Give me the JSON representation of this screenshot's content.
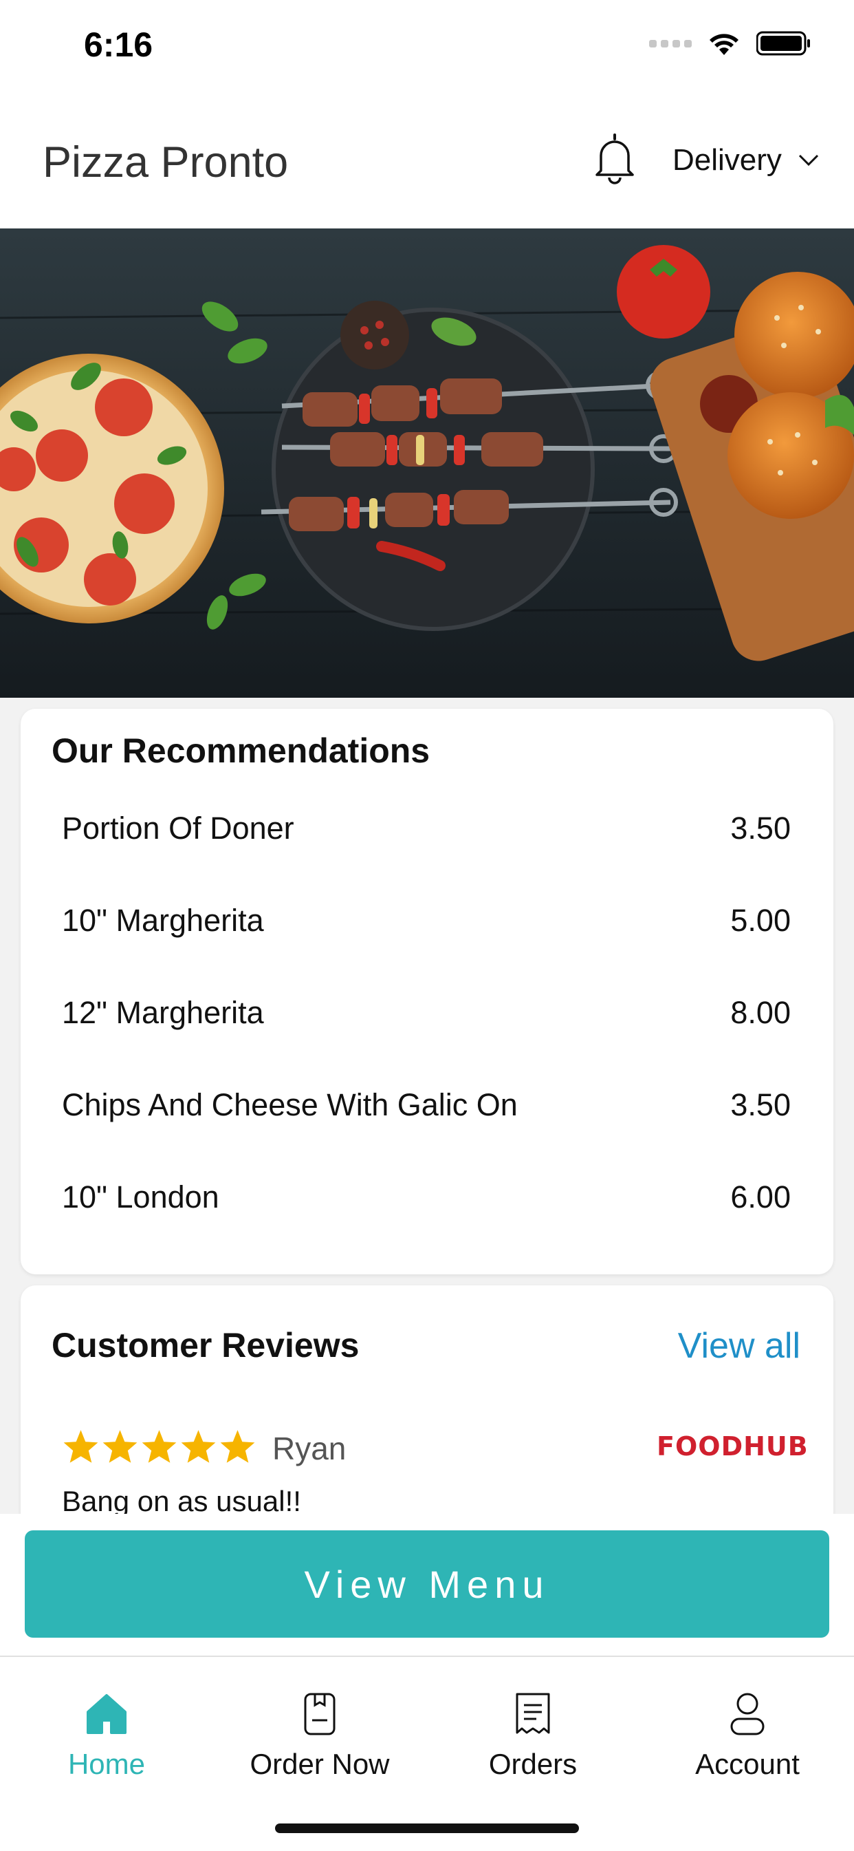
{
  "status_bar": {
    "time": "6:16"
  },
  "header": {
    "title": "Pizza Pronto",
    "order_type": "Delivery"
  },
  "recommendations": {
    "title": "Our Recommendations",
    "items": [
      {
        "name": "Portion Of Doner",
        "price": "3.50"
      },
      {
        "name": "10\" Margherita",
        "price": "5.00"
      },
      {
        "name": "12\" Margherita",
        "price": "8.00"
      },
      {
        "name": "Chips And Cheese With Galic On",
        "price": "3.50"
      },
      {
        "name": "10\" London",
        "price": "6.00"
      }
    ]
  },
  "reviews": {
    "title": "Customer Reviews",
    "view_all_label": "View all",
    "items": [
      {
        "stars": 5,
        "reviewer": "Ryan",
        "source": "FOODHUB",
        "text": "Bang on as usual!!"
      }
    ]
  },
  "cta": {
    "label": "View Menu"
  },
  "bottom_nav": {
    "items": [
      {
        "label": "Home",
        "icon": "home-icon",
        "active": true
      },
      {
        "label": "Order Now",
        "icon": "order-now-icon",
        "active": false
      },
      {
        "label": "Orders",
        "icon": "receipt-icon",
        "active": false
      },
      {
        "label": "Account",
        "icon": "user-icon",
        "active": false
      }
    ]
  },
  "colors": {
    "accent": "#2eb5b5",
    "link": "#1f8fc8",
    "star": "#f6b400",
    "foodhub": "#d0202e"
  }
}
